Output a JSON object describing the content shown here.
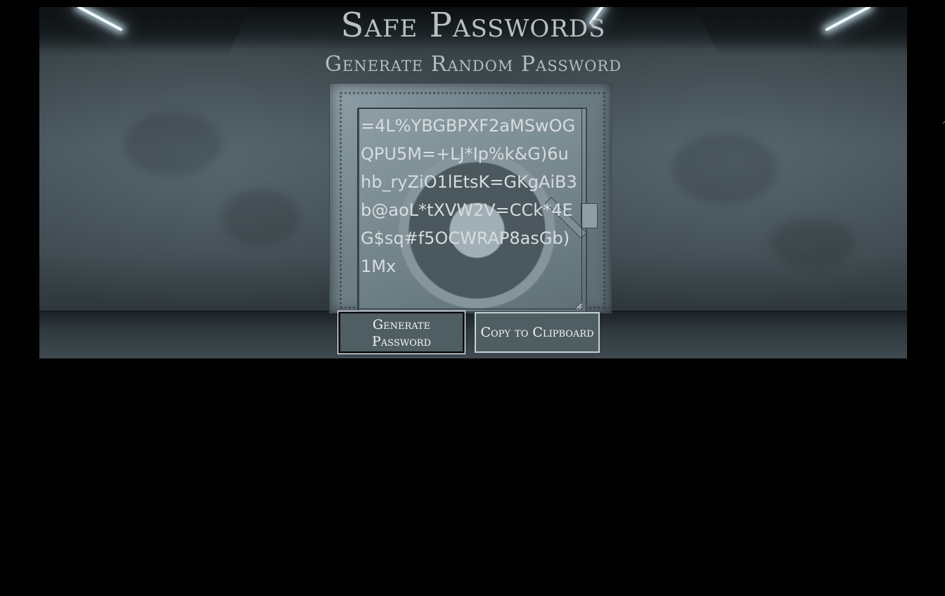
{
  "header": {
    "title": "Safe Passwords",
    "subtitle": "Generate Random Password"
  },
  "password": {
    "value": "=4L%YBGBPXF2aMSwOGQPU5M=+LJ*Ip%k&G)6uhb_ryZiO1lEtsK=GKgAiB3b@aoL*tXVW2V=CCk*4EG$sq#f5OCWRAP8asGb)1Mx"
  },
  "actions": {
    "generate_label": "Generate Password",
    "copy_label": "Copy to Clipboard"
  },
  "colors": {
    "page_background": "#000000",
    "button_background": "#4f5e62",
    "button_text": "#f3f5f5",
    "heading_text": "#b9c1c4"
  },
  "icons": {
    "background_scene": "vault-room-image"
  }
}
